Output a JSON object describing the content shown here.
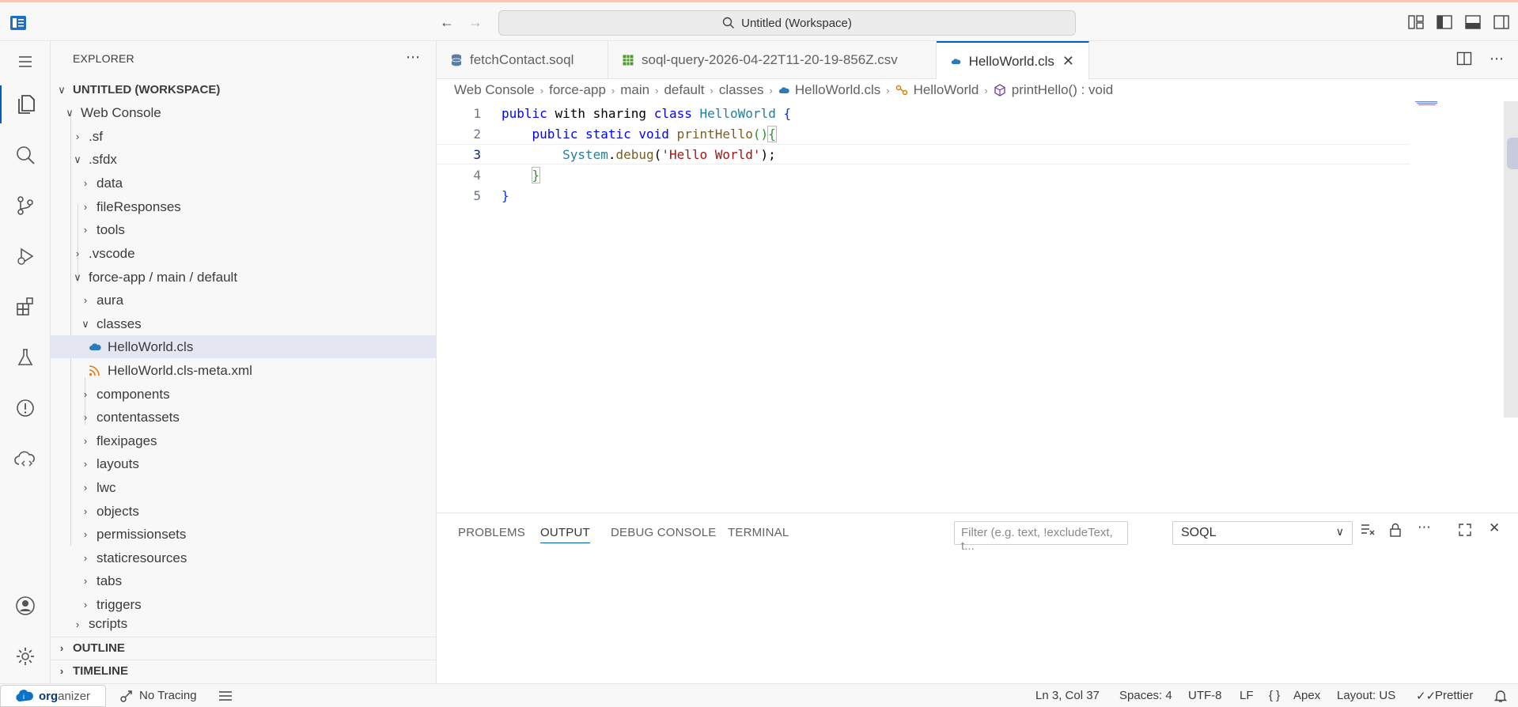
{
  "titlebar": {
    "workspace_title": "Untitled (Workspace)"
  },
  "sidebar": {
    "title": "EXPLORER",
    "workspace": "UNTITLED (WORKSPACE)",
    "tree": [
      {
        "label": "Web Console"
      },
      {
        "label": ".sf"
      },
      {
        "label": ".sfdx"
      },
      {
        "label": "data"
      },
      {
        "label": "fileResponses"
      },
      {
        "label": "tools"
      },
      {
        "label": ".vscode"
      },
      {
        "label": "force-app / main / default"
      },
      {
        "label": "aura"
      },
      {
        "label": "classes"
      },
      {
        "label": "HelloWorld.cls"
      },
      {
        "label": "HelloWorld.cls-meta.xml"
      },
      {
        "label": "components"
      },
      {
        "label": "contentassets"
      },
      {
        "label": "flexipages"
      },
      {
        "label": "layouts"
      },
      {
        "label": "lwc"
      },
      {
        "label": "objects"
      },
      {
        "label": "permissionsets"
      },
      {
        "label": "staticresources"
      },
      {
        "label": "tabs"
      },
      {
        "label": "triggers"
      },
      {
        "label": "scripts"
      }
    ],
    "outline": "OUTLINE",
    "timeline": "TIMELINE"
  },
  "tabs": [
    {
      "label": "fetchContact.soql"
    },
    {
      "label": "soql-query-2026-04-22T11-20-19-856Z.csv"
    },
    {
      "label": "HelloWorld.cls"
    }
  ],
  "breadcrumb": [
    "Web Console",
    "force-app",
    "main",
    "default",
    "classes",
    "HelloWorld.cls",
    "HelloWorld",
    "printHello() : void"
  ],
  "code": {
    "line_numbers": [
      "1",
      "2",
      "3",
      "4",
      "5"
    ],
    "l1": {
      "kw1": "public",
      "kw2": "with",
      "w": "sharing",
      "kw3": "class",
      "cls": "HelloWorld",
      "br": "{"
    },
    "l2": {
      "kw1": "public",
      "kw2": "static",
      "kw3": "void",
      "fn": "printHello",
      "br": "()",
      "br2": "{"
    },
    "l3": {
      "cls": "System",
      "dot": ".",
      "fn": "debug",
      "open": "(",
      "str": "'Hello World'",
      "close": ");"
    },
    "l4": {
      "br": "}"
    },
    "l5": {
      "br": "}"
    }
  },
  "panel": {
    "tabs": [
      "PROBLEMS",
      "OUTPUT",
      "DEBUG CONSOLE",
      "TERMINAL"
    ],
    "active_tab": "OUTPUT",
    "filter_placeholder": "Filter (e.g. text, !excludeText, t...",
    "channel": "SOQL"
  },
  "statusbar": {
    "org_bold": "org",
    "org_rest": "anizer",
    "tracing": "No Tracing",
    "position": "Ln 3, Col 37",
    "spaces": "Spaces: 4",
    "encoding": "UTF-8",
    "eol": "LF",
    "language": "Apex",
    "layout": "Layout: US",
    "formatter": "Prettier"
  },
  "colors": {
    "accent": "#005fb8",
    "keyword": "#0000ff",
    "type": "#267f99",
    "function": "#795e26",
    "string": "#a31515"
  }
}
